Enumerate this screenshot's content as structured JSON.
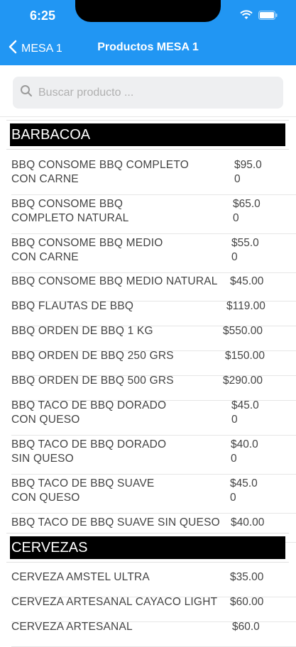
{
  "status_bar": {
    "time": "6:25"
  },
  "nav": {
    "back_label": "MESA 1",
    "title": "Productos MESA 1"
  },
  "search": {
    "placeholder": "Buscar producto ..."
  },
  "sections": [
    {
      "title": "BARBACOA",
      "items": [
        {
          "name": [
            "BBQ CONSOME BBQ COMPLETO",
            "CON CARNE"
          ],
          "price": [
            "$95.0",
            "0"
          ]
        },
        {
          "name": [
            "BBQ CONSOME BBQ",
            "COMPLETO NATURAL"
          ],
          "price": [
            "$65.0",
            "0"
          ]
        },
        {
          "name": [
            "BBQ CONSOME BBQ MEDIO",
            "CON CARNE"
          ],
          "price": [
            "$55.0",
            "0"
          ]
        },
        {
          "name": [
            "BBQ CONSOME BBQ MEDIO NATURAL"
          ],
          "price": [
            "$45.00"
          ]
        },
        {
          "name": [
            "BBQ FLAUTAS DE BBQ"
          ],
          "price": [
            "$119.00"
          ]
        },
        {
          "name": [
            "BBQ ORDEN DE BBQ 1 KG"
          ],
          "price": [
            "$550.00"
          ]
        },
        {
          "name": [
            "BBQ ORDEN DE BBQ 250 GRS"
          ],
          "price": [
            "$150.00"
          ]
        },
        {
          "name": [
            "BBQ ORDEN DE BBQ 500 GRS"
          ],
          "price": [
            "$290.00"
          ]
        },
        {
          "name": [
            "BBQ TACO DE BBQ DORADO",
            "CON QUESO"
          ],
          "price": [
            "$45.0",
            "0"
          ]
        },
        {
          "name": [
            "BBQ TACO DE BBQ DORADO",
            "SIN QUESO"
          ],
          "price": [
            "$40.0",
            "0"
          ]
        },
        {
          "name": [
            "BBQ TACO DE BBQ SUAVE",
            "CON QUESO"
          ],
          "price": [
            "$45.0",
            "0"
          ]
        },
        {
          "name": [
            "BBQ TACO DE BBQ SUAVE SIN QUESO"
          ],
          "price": [
            "$40.00"
          ]
        }
      ]
    },
    {
      "title": "CERVEZAS",
      "items": [
        {
          "name": [
            "CERVEZA AMSTEL ULTRA"
          ],
          "price": [
            "$35.00"
          ]
        },
        {
          "name": [
            "CERVEZA ARTESANAL CAYACO LIGHT"
          ],
          "price": [
            "$60.00"
          ]
        },
        {
          "name": [
            "CERVEZA ARTESANAL"
          ],
          "price": [
            "$60.0"
          ]
        }
      ]
    }
  ],
  "colors": {
    "nav_bg": "#2196f3",
    "section_bg": "#000000"
  },
  "icons": {
    "back": "chevron-left-icon",
    "search": "search-icon",
    "wifi": "wifi-icon",
    "battery": "battery-icon"
  }
}
